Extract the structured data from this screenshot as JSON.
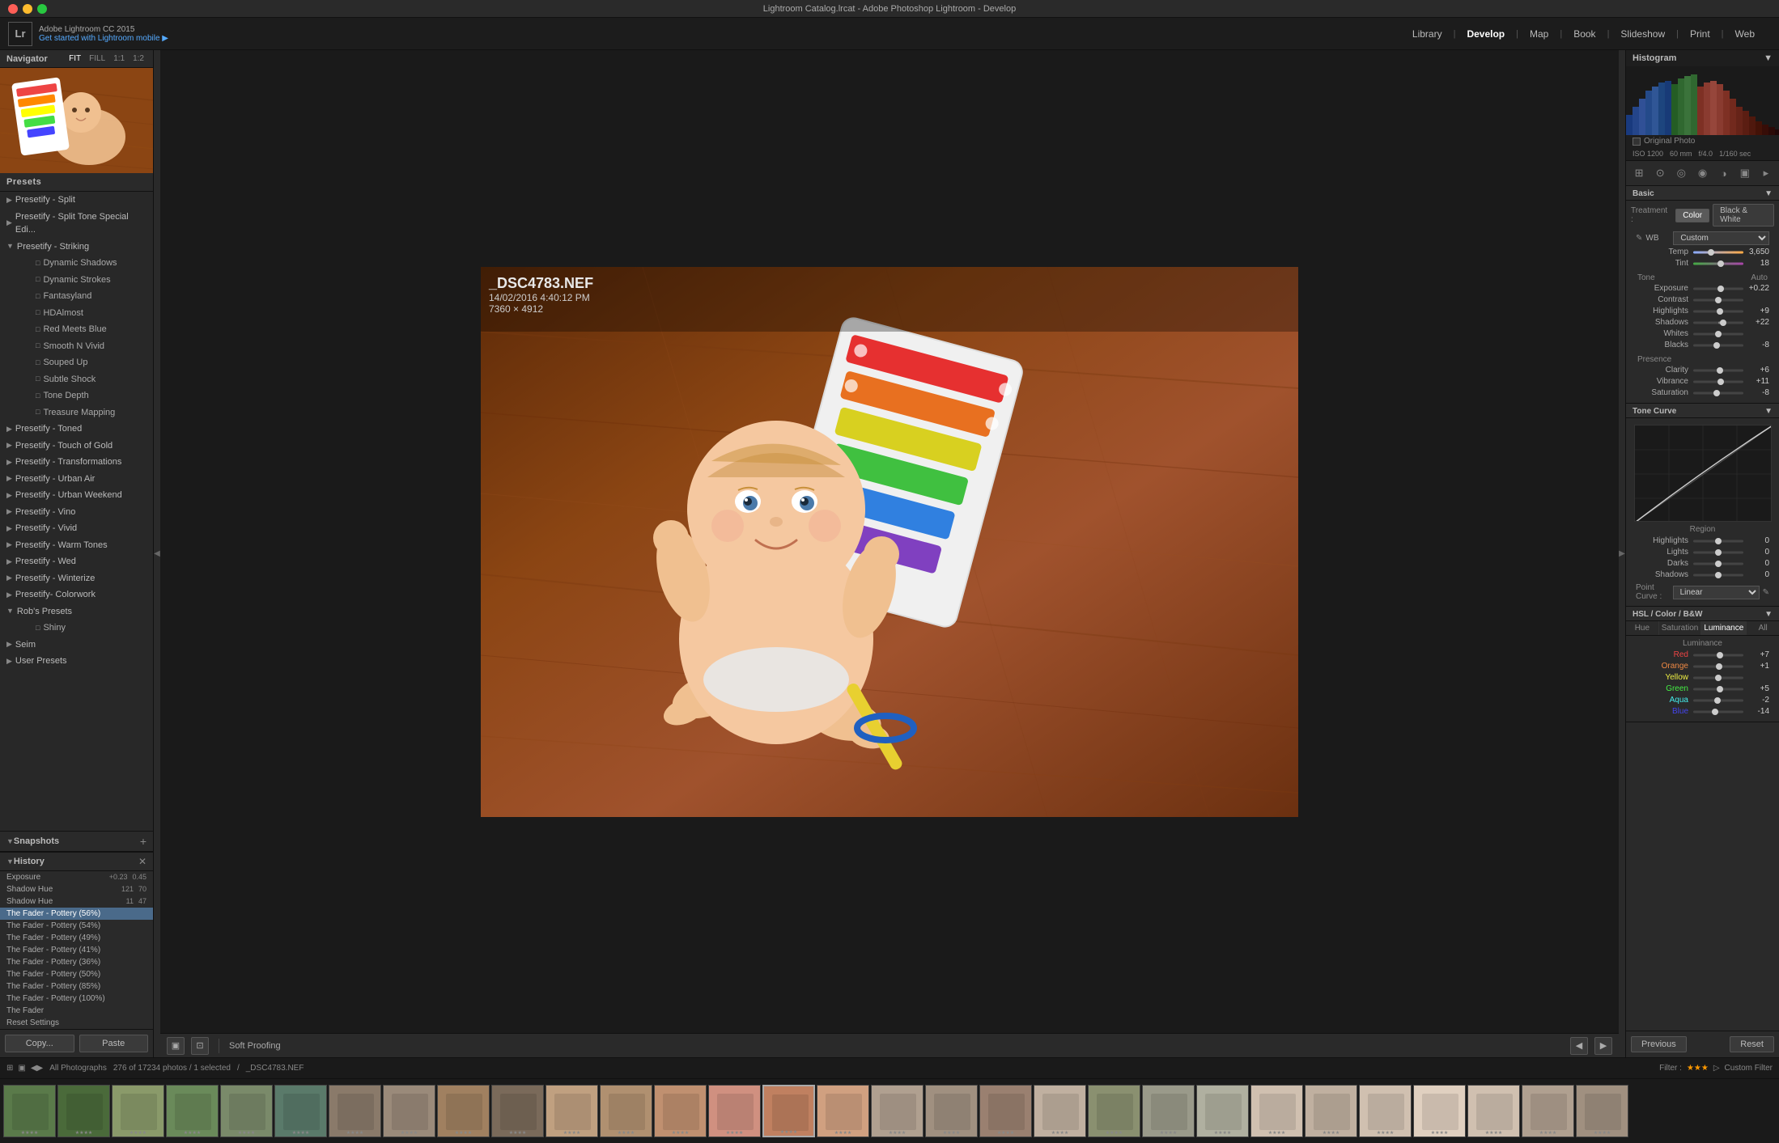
{
  "titlebar": {
    "title": "Lightroom Catalog.lrcat - Adobe Photoshop Lightroom - Develop"
  },
  "topbar": {
    "logo": "Lr",
    "version": "Adobe Lightroom CC 2015",
    "promo": "Get started with Lightroom mobile ▶",
    "nav_tabs": [
      "Library",
      "Develop",
      "Map",
      "Book",
      "Slideshow",
      "Print",
      "Web"
    ],
    "active_tab": "Develop"
  },
  "left_panel": {
    "navigator": {
      "title": "Navigator",
      "zoom_levels": [
        "FIT",
        "FILL",
        "1:1",
        "1:2"
      ]
    },
    "presets": [
      {
        "type": "group",
        "label": "Presetify - Split",
        "expanded": false
      },
      {
        "type": "group",
        "label": "Presetify - Split Tone Special Edi...",
        "expanded": false
      },
      {
        "type": "group",
        "label": "Presetify - Striking",
        "expanded": true
      },
      {
        "type": "item",
        "label": "Dynamic Shadows",
        "indent": 2
      },
      {
        "type": "item",
        "label": "Dynamic Strokes",
        "indent": 2
      },
      {
        "type": "item",
        "label": "Fantasyland",
        "indent": 2
      },
      {
        "type": "item",
        "label": "HDAlmost",
        "indent": 2
      },
      {
        "type": "item",
        "label": "Red Meets Blue",
        "indent": 2
      },
      {
        "type": "item",
        "label": "Smooth N Vivid",
        "indent": 2
      },
      {
        "type": "item",
        "label": "Souped Up",
        "indent": 2
      },
      {
        "type": "item",
        "label": "Subtle Shock",
        "indent": 2
      },
      {
        "type": "item",
        "label": "Tone Depth",
        "indent": 2
      },
      {
        "type": "item",
        "label": "Treasure Mapping",
        "indent": 2
      },
      {
        "type": "group",
        "label": "Presetify - Toned",
        "expanded": false
      },
      {
        "type": "group",
        "label": "Presetify - Touch of Gold",
        "expanded": false
      },
      {
        "type": "group",
        "label": "Presetify - Transformations",
        "expanded": false
      },
      {
        "type": "group",
        "label": "Presetify - Urban Air",
        "expanded": false
      },
      {
        "type": "group",
        "label": "Presetify - Urban Weekend",
        "expanded": false
      },
      {
        "type": "group",
        "label": "Presetify - Vino",
        "expanded": false
      },
      {
        "type": "group",
        "label": "Presetify - Vivid",
        "expanded": false
      },
      {
        "type": "group",
        "label": "Presetify - Warm Tones",
        "expanded": false
      },
      {
        "type": "group",
        "label": "Presetify - Wed",
        "expanded": false
      },
      {
        "type": "group",
        "label": "Presetify - Winterize",
        "expanded": false
      },
      {
        "type": "group",
        "label": "Presetify- Colorwork",
        "expanded": false
      },
      {
        "type": "group",
        "label": "Rob's Presets",
        "expanded": true
      },
      {
        "type": "item",
        "label": "Shiny",
        "indent": 2
      },
      {
        "type": "group",
        "label": "Seim",
        "expanded": false
      },
      {
        "type": "group",
        "label": "User Presets",
        "expanded": false
      }
    ],
    "snapshots": {
      "title": "Snapshots",
      "items": []
    },
    "history": {
      "title": "History",
      "items": [
        {
          "label": "Exposure",
          "val1": "+0.23",
          "val2": "0.45"
        },
        {
          "label": "Shadow Hue",
          "val1": "121",
          "val2": "70"
        },
        {
          "label": "Shadow Hue",
          "val1": "11",
          "val2": "47"
        },
        {
          "label": "The Fader - Pottery (56%)",
          "selected": true
        },
        {
          "label": "The Fader - Pottery (54%)"
        },
        {
          "label": "The Fader - Pottery (49%)"
        },
        {
          "label": "The Fader - Pottery (41%)"
        },
        {
          "label": "The Fader - Pottery (36%)"
        },
        {
          "label": "The Fader - Pottery (50%)"
        },
        {
          "label": "The Fader - Pottery (85%)"
        },
        {
          "label": "The Fader - Pottery (100%)"
        },
        {
          "label": "The Fader"
        },
        {
          "label": "Reset Settings"
        }
      ]
    },
    "copy_btn": "Copy...",
    "paste_btn": "Paste"
  },
  "photo": {
    "filename": "_DSC4783.NEF",
    "date": "14/02/2016 4:40:12 PM",
    "dimensions": "7360 × 4912"
  },
  "toolbar": {
    "soft_proofing": "Soft Proofing"
  },
  "statusbar": {
    "library": "All Photographs",
    "count": "276 of 17234 photos / 1 selected",
    "filename": "_DSC4783.NEF",
    "filter_label": "Filter :",
    "custom_filter": "Custom Filter"
  },
  "right_panel": {
    "histogram": {
      "title": "Histogram",
      "exif": {
        "iso": "ISO 1200",
        "focal": "60 mm",
        "aperture": "f/4.0",
        "shutter": "1/160 sec"
      },
      "original_photo": "Original Photo"
    },
    "tools": [
      "crop",
      "heal",
      "redeye",
      "brush",
      "filter",
      "range"
    ],
    "basic": {
      "title": "Basic",
      "treatment_label": "Treatment :",
      "color_btn": "Color",
      "bw_btn": "Black & White",
      "wb_label": "WB",
      "wb_value": "Custom",
      "temp_label": "Temp",
      "temp_value": "3,650",
      "tint_label": "Tint",
      "tint_value": "18",
      "tone_label": "Tone",
      "tone_auto": "Auto",
      "exposure_label": "Exposure",
      "exposure_value": "+0.22",
      "contrast_label": "Contrast",
      "contrast_value": "",
      "highlights_label": "Highlights",
      "highlights_value": "+9",
      "shadows_label": "Shadows",
      "shadows_value": "+22",
      "whites_label": "Whites",
      "whites_value": "",
      "blacks_label": "Blacks",
      "blacks_value": "-8",
      "presence_label": "Presence",
      "clarity_label": "Clarity",
      "clarity_value": "+6",
      "vibrance_label": "Vibrance",
      "vibrance_value": "+11",
      "saturation_label": "Saturation",
      "saturation_value": "-8"
    },
    "tone_curve": {
      "title": "Tone Curve",
      "highlights_label": "Highlights",
      "highlights_value": "0",
      "lights_label": "Lights",
      "lights_value": "0",
      "darks_label": "Darks",
      "darks_value": "0",
      "shadows_label": "Shadows",
      "shadows_value": "0",
      "point_curve_label": "Point Curve :",
      "point_curve_value": "Linear"
    },
    "hsl": {
      "title": "HSL / Color / B&W",
      "tabs": [
        "Hue",
        "Saturation",
        "Luminance",
        "All"
      ],
      "active_tab": "Luminance",
      "luminance_title": "Luminance",
      "colors": [
        {
          "label": "Red",
          "value": "+7"
        },
        {
          "label": "Orange",
          "value": "+1"
        },
        {
          "label": "Yellow",
          "value": ""
        },
        {
          "label": "Green",
          "value": "+5"
        },
        {
          "label": "Aqua",
          "value": "-2"
        },
        {
          "label": "Blue",
          "value": "-14"
        }
      ]
    },
    "prev_btn": "Previous",
    "reset_btn": "Reset"
  },
  "filmstrip": {
    "thumbs": [
      {
        "color": "#5a7a4a",
        "stars": "★★★★"
      },
      {
        "color": "#4a6a3a",
        "stars": "★★★★"
      },
      {
        "color": "#8a9a6a",
        "stars": "★★★★"
      },
      {
        "color": "#6a8a5a",
        "stars": "★★★★"
      },
      {
        "color": "#7a8a6a",
        "stars": "★★★★"
      },
      {
        "color": "#5a7a6a",
        "stars": "★★★★"
      },
      {
        "color": "#8a7a6a",
        "stars": "★★★★"
      },
      {
        "color": "#9a8a7a",
        "stars": "★★★★"
      },
      {
        "color": "#a08060",
        "stars": "★★★★"
      },
      {
        "color": "#7a6a5a",
        "stars": "★★★★"
      },
      {
        "color": "#c0a080",
        "stars": "★★★★"
      },
      {
        "color": "#b09070",
        "stars": "★★★★"
      },
      {
        "color": "#c09070",
        "stars": "★★★★"
      },
      {
        "color": "#d09080",
        "stars": "★★★★"
      },
      {
        "color": "#c08060",
        "stars": "★★★★"
      },
      {
        "color": "#d0a080",
        "stars": "★★★★"
      },
      {
        "color": "#b0a090",
        "stars": "★★★★"
      },
      {
        "color": "#a09080",
        "stars": "★★★★"
      },
      {
        "color": "#9a8070",
        "stars": "★★★★"
      },
      {
        "color": "#c0b0a0",
        "stars": "★★★★"
      },
      {
        "color": "#8a9070",
        "stars": "★★★★"
      },
      {
        "color": "#9a9a8a",
        "stars": "★★★★"
      },
      {
        "color": "#b0b0a0",
        "stars": "★★★★"
      },
      {
        "color": "#d0c0b0",
        "stars": "★★★★"
      },
      {
        "color": "#c0b0a0",
        "stars": "★★★★"
      },
      {
        "color": "#d0c0b0",
        "stars": "★★★★"
      },
      {
        "color": "#e0d0c0",
        "stars": "★★★★"
      },
      {
        "color": "#d0c0b0",
        "stars": "★★★★"
      },
      {
        "color": "#b0a090",
        "stars": "★★★★"
      },
      {
        "color": "#a09080",
        "stars": "★★★★"
      }
    ]
  }
}
